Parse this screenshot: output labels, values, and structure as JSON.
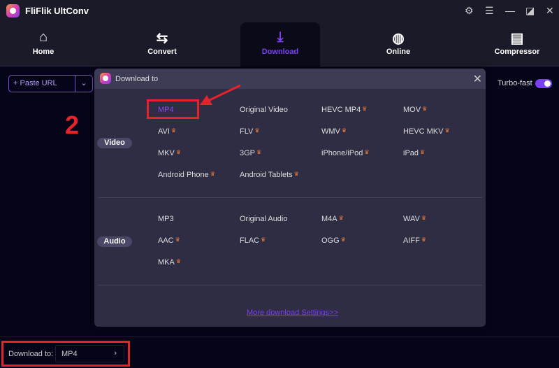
{
  "app": {
    "title": "FliFlik UltConv"
  },
  "window_controls": [
    "gear-icon",
    "menu-icon",
    "minimize-icon",
    "maximize-icon",
    "close-icon"
  ],
  "tabs": [
    {
      "label": "Home",
      "icon": "home-icon"
    },
    {
      "label": "Convert",
      "icon": "convert-icon"
    },
    {
      "label": "Download",
      "icon": "download-icon",
      "active": true
    },
    {
      "label": "Online",
      "icon": "globe-icon"
    },
    {
      "label": "Compressor",
      "icon": "compressor-icon"
    }
  ],
  "toolbar": {
    "paste_url": "Paste URL",
    "turbo_label": "Turbo-fast",
    "turbo_on": true
  },
  "modal": {
    "title": "Download to",
    "video_label": "Video",
    "audio_label": "Audio",
    "video_formats": [
      {
        "name": "MP4",
        "premium": false,
        "selected": true
      },
      {
        "name": "Original Video",
        "premium": false
      },
      {
        "name": "HEVC MP4",
        "premium": true
      },
      {
        "name": "MOV",
        "premium": true
      },
      {
        "name": "AVI",
        "premium": true
      },
      {
        "name": "FLV",
        "premium": true
      },
      {
        "name": "WMV",
        "premium": true
      },
      {
        "name": "HEVC MKV",
        "premium": true
      },
      {
        "name": "MKV",
        "premium": true
      },
      {
        "name": "3GP",
        "premium": true
      },
      {
        "name": "iPhone/iPod",
        "premium": true
      },
      {
        "name": "iPad",
        "premium": true
      },
      {
        "name": "Android Phone",
        "premium": true
      },
      {
        "name": "Android Tablets",
        "premium": true
      }
    ],
    "audio_formats": [
      {
        "name": "MP3",
        "premium": false
      },
      {
        "name": "Original Audio",
        "premium": false
      },
      {
        "name": "M4A",
        "premium": true
      },
      {
        "name": "WAV",
        "premium": true
      },
      {
        "name": "AAC",
        "premium": true
      },
      {
        "name": "FLAC",
        "premium": true
      },
      {
        "name": "OGG",
        "premium": true
      },
      {
        "name": "AIFF",
        "premium": true
      },
      {
        "name": "MKA",
        "premium": true
      }
    ],
    "more_settings": "More download Settings>>"
  },
  "annotation": {
    "step": "2"
  },
  "footer": {
    "download_to_label": "Download to:",
    "download_to_value": "MP4"
  },
  "colors": {
    "accent": "#7b3ff2",
    "highlight": "#e8222b",
    "premium": "#f07a3a"
  }
}
